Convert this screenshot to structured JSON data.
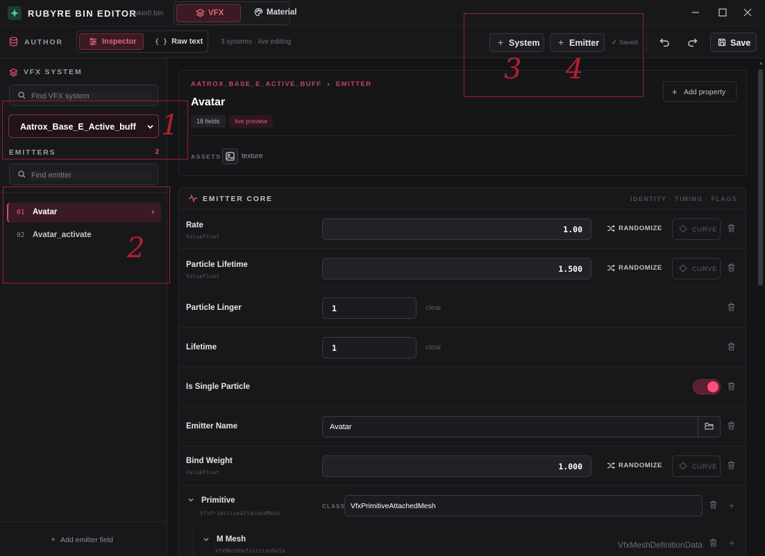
{
  "app": {
    "name": "RUBYRE BIN EDITOR",
    "file": "/ skin0.bin",
    "tabs": [
      {
        "label": "VFX",
        "icon": "layers-icon",
        "active": true
      },
      {
        "label": "Material",
        "icon": "palette-icon",
        "active": false
      }
    ],
    "window_controls": [
      "minimize-icon",
      "maximize-icon",
      "close-icon"
    ]
  },
  "toolbar": {
    "section_label": "AUTHOR",
    "modes": [
      {
        "label": "Inspector",
        "icon": "sliders-icon",
        "active": true
      },
      {
        "label": "Raw text",
        "icon": "braces-icon",
        "glyph": "{ }",
        "active": false
      }
    ],
    "status": "3 systems · live editing",
    "add_system_label": "System",
    "add_emitter_label": "Emitter",
    "saved_label": "Saved",
    "saved_check": "✓",
    "save_label": "Save"
  },
  "sidebar": {
    "vfx_title": "VFX SYSTEM",
    "system_search_placeholder": "Find VFX system",
    "selected_system": "Aatrox_Base_E_Active_buff",
    "emitters_title": "EMITTERS",
    "emitter_count": "2",
    "emitter_search_placeholder": "Find emitter",
    "emitters": [
      {
        "num": "01",
        "name": "Avatar",
        "active": true,
        "chevron": "›"
      },
      {
        "num": "02",
        "name": "Avatar_activate",
        "active": false
      }
    ],
    "add_field_label": "Add emitter field",
    "add_field_plus": "+"
  },
  "header": {
    "breadcrumb_root": "AATROX_BASE_E_ACTIVE_BUFF",
    "breadcrumb_sep": "›",
    "breadcrumb_leaf": "EMITTER",
    "title": "Avatar",
    "fields_pill": "18 fields",
    "live_pill": "live preview",
    "assets_label": "ASSETS",
    "asset_name": "texture",
    "add_property_label": "Add property"
  },
  "core": {
    "title": "EMITTER CORE",
    "tags": "IDENTITY · TIMING · FLAGS",
    "randomize_label": "RANDOMIZE",
    "curve_label": "CURVE",
    "clear_label": "clear",
    "class_label": "CLASS",
    "rows": {
      "rate": {
        "label": "Rate",
        "type": "ValueFloat",
        "value": "1.00"
      },
      "particle_lifetime": {
        "label": "Particle Lifetime",
        "type": "ValueFloat",
        "value": "1.500"
      },
      "particle_linger": {
        "label": "Particle Linger",
        "value": "1"
      },
      "lifetime": {
        "label": "Lifetime",
        "value": "1"
      },
      "is_single_particle": {
        "label": "Is Single Particle",
        "value": true
      },
      "emitter_name": {
        "label": "Emitter Name",
        "value": "Avatar"
      },
      "bind_weight": {
        "label": "Bind Weight",
        "type": "ValueFloat",
        "value": "1.000"
      },
      "primitive": {
        "label": "Primitive",
        "type": "VfxPrimitiveAttachedMesh",
        "class_value": "VfxPrimitiveAttachedMesh"
      },
      "m_mesh": {
        "label": "M Mesh",
        "type": "VfxMeshDefinitionData",
        "class_value": "VfxMeshDefinitionData"
      }
    }
  },
  "annotations": {
    "marks": [
      "1",
      "2",
      "3",
      "4"
    ],
    "color": "#a11d2e"
  },
  "colors": {
    "accent": "#d0506a",
    "accent_bg": "#3b1a23",
    "toggle_on": "#ff4f7a",
    "background": "#141417",
    "panel": "#18181b"
  }
}
